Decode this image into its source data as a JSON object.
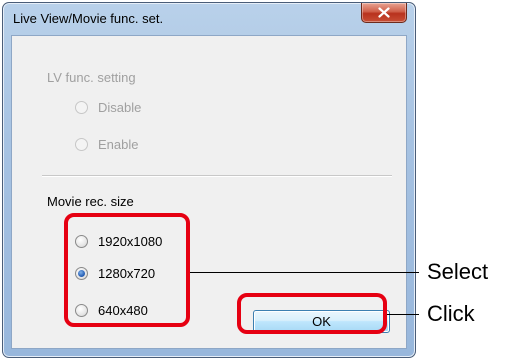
{
  "window": {
    "title": "Live View/Movie func. set.",
    "close_icon": "close-icon"
  },
  "lv_func": {
    "heading": "LV func. setting",
    "options": [
      {
        "label": "Disable",
        "checked": false,
        "enabled": false
      },
      {
        "label": "Enable",
        "checked": false,
        "enabled": false
      }
    ]
  },
  "movie_rec": {
    "heading": "Movie rec. size",
    "options": [
      {
        "label": "1920x1080",
        "checked": false
      },
      {
        "label": "1280x720",
        "checked": true
      },
      {
        "label": "640x480",
        "checked": false
      }
    ]
  },
  "buttons": {
    "ok_label": "OK"
  },
  "annotations": {
    "select_label": "Select",
    "click_label": "Click",
    "highlight_color": "#e60012"
  }
}
